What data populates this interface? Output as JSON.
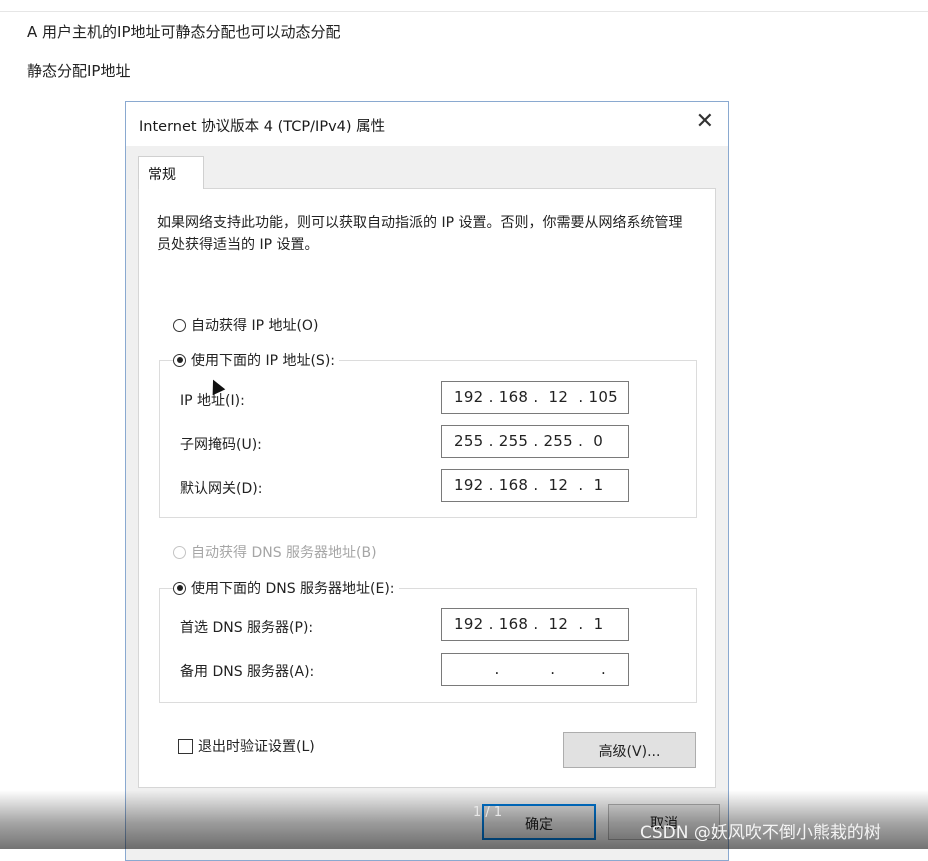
{
  "article": {
    "line1": "A 用户主机的IP地址可静态分配也可以动态分配",
    "line2": "静态分配IP地址"
  },
  "dialog": {
    "title": "Internet 协议版本 4 (TCP/IPv4) 属性",
    "tab_general": "常规",
    "description": "如果网络支持此功能，则可以获取自动指派的 IP 设置。否则，你需要从网络系统管理员处获得适当的 IP 设置。",
    "radio_auto_ip": "自动获得 IP 地址(O)",
    "radio_manual_ip": "使用下面的 IP 地址(S):",
    "ip_label": "IP 地址(I):",
    "ip_value": "192 . 168 .  12  . 105",
    "mask_label": "子网掩码(U):",
    "mask_value": "255 . 255 . 255 .  0",
    "gateway_label": "默认网关(D):",
    "gateway_value": "192 . 168 .  12  .  1",
    "radio_auto_dns": "自动获得 DNS 服务器地址(B)",
    "radio_manual_dns": "使用下面的 DNS 服务器地址(E):",
    "pref_dns_label": "首选 DNS 服务器(P):",
    "pref_dns_value": "192 . 168 .  12  .  1",
    "alt_dns_label": "备用 DNS 服务器(A):",
    "alt_dns_value": "        .          .         .",
    "validate_label": "退出时验证设置(L)",
    "advanced_label": "高级(V)...",
    "ok_label": "确定",
    "cancel_label": "取消"
  },
  "pager": "1 / 1",
  "watermark": "CSDN @妖风吹不倒小熊栽的树",
  "colors": {
    "ok_border": "#0078d7",
    "dialog_border": "#8aa9d0"
  }
}
